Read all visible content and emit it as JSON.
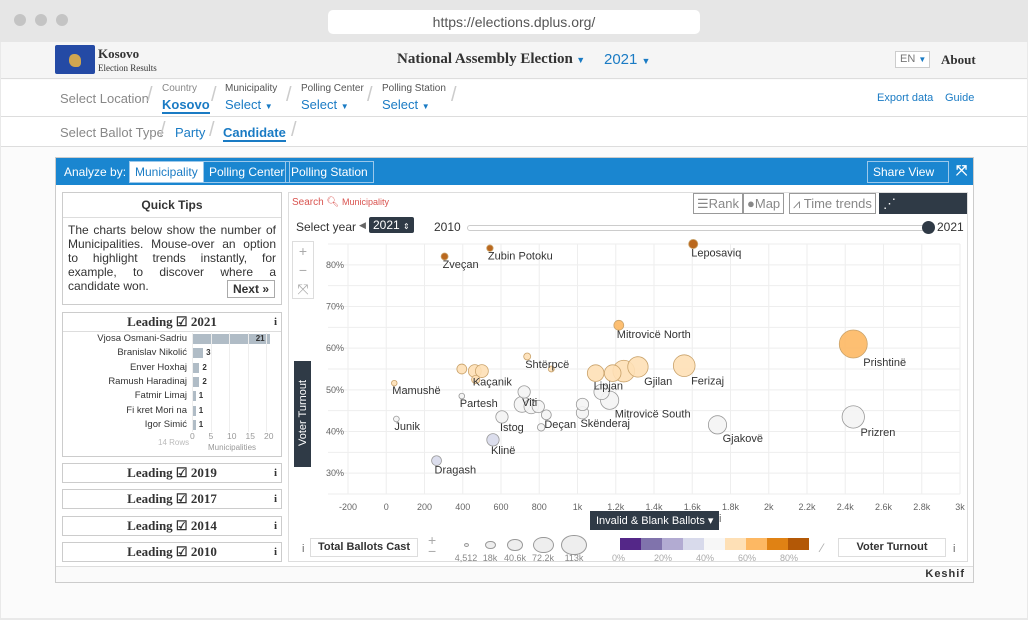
{
  "browser": {
    "url": "https://elections.dplus.org/"
  },
  "header": {
    "brand": "Kosovo",
    "brand_sub": "Election Results",
    "election": "National Assembly Election",
    "year": "2021",
    "lang": "EN",
    "about": "About"
  },
  "location": {
    "label": "Select Location",
    "country_label": "Country",
    "country": "Kosovo",
    "municipality_label": "Municipality",
    "municipality": "Select",
    "center_label": "Polling Center",
    "center": "Select",
    "station_label": "Polling Station",
    "station": "Select",
    "export": "Export data",
    "guide": "Guide"
  },
  "ballot": {
    "label": "Select Ballot Type",
    "party": "Party",
    "candidate": "Candidate"
  },
  "analyze": {
    "label": "Analyze by:",
    "tabs": [
      "Municipality",
      "Polling Center",
      "Polling Station"
    ],
    "active": "Municipality",
    "share": "Share View"
  },
  "tips": {
    "title": "Quick Tips",
    "text": "The charts below show the number of Municipalities. Mouse-over an option to highlight trends instantly, for example, to discover where a candidate won.",
    "next": "Next »"
  },
  "leading": {
    "title": "Leading",
    "year": "2021",
    "rows_label": "14 Rows",
    "axis_label": "Municipalities",
    "ticks": [
      "0",
      "5",
      "10",
      "15",
      "20"
    ],
    "items": [
      {
        "name": "Vjosa Osmani-Sadriu",
        "value": 21
      },
      {
        "name": "Branislav Nikolić",
        "value": 3
      },
      {
        "name": "Enver Hoxhaj",
        "value": 2
      },
      {
        "name": "Ramush Haradinaj",
        "value": 2
      },
      {
        "name": "Fatmir Limaj",
        "value": 1
      },
      {
        "name": "Fi kret Mori na",
        "value": 1
      },
      {
        "name": "Igor Simić",
        "value": 1
      }
    ]
  },
  "other_years": [
    "2019",
    "2017",
    "2014",
    "2010"
  ],
  "views": {
    "search": "Search",
    "search_placeholder": "Municipality",
    "rank": "Rank",
    "map": "Map",
    "trends": "Time trends",
    "correlations": "Correlations",
    "active": "Correlations"
  },
  "year_select": {
    "label": "Select year",
    "value": "2021",
    "min": "2010",
    "max": "2021",
    "position": 1.0
  },
  "chart_data": {
    "type": "scatter",
    "xlabel": "Invalid & Blank Ballots",
    "ylabel": "Voter Turnout",
    "xlim": [
      -200,
      3000
    ],
    "ylim": [
      25,
      85
    ],
    "xticks": [
      "-200",
      "0",
      "200",
      "400",
      "600",
      "800",
      "1k",
      "1.2k",
      "1.4k",
      "1.6k",
      "1.8k",
      "2k",
      "2.2k",
      "2.4k",
      "2.6k",
      "2.8k",
      "3k"
    ],
    "yticks": [
      "30%",
      "40%",
      "50%",
      "60%",
      "70%",
      "80%"
    ],
    "grid": true,
    "size_label": "Total Ballots Cast",
    "color_label": "Voter Turnout",
    "size_legend": [
      "4,512",
      "18k",
      "40.6k",
      "72.2k",
      "113k"
    ],
    "color_legend": [
      "0%",
      "20%",
      "40%",
      "60%",
      "80%"
    ],
    "color_scale": [
      "#542788",
      "#8073ac",
      "#b2abd2",
      "#d8daeb",
      "#f7f7f7",
      "#fee0b6",
      "#fdb863",
      "#e08214",
      "#b35806"
    ],
    "points": [
      {
        "name": "Zveçan",
        "x": 305,
        "y": 82,
        "size": 7000
      },
      {
        "name": "Zubin Potoku",
        "x": 542,
        "y": 84,
        "size": 6000
      },
      {
        "name": "Leposaviq",
        "x": 1605,
        "y": 85,
        "size": 12000
      },
      {
        "name": "Mitrovicë North",
        "x": 1216,
        "y": 65.5,
        "size": 14000
      },
      {
        "name": "Prishtinë",
        "x": 2442,
        "y": 61,
        "size": 113000
      },
      {
        "name": "Ferizaj",
        "x": 1558,
        "y": 55.8,
        "size": 68000
      },
      {
        "name": "Gjilan",
        "x": 1316,
        "y": 55.5,
        "size": 60000
      },
      {
        "name": "",
        "x": 1242,
        "y": 54.5,
        "size": 68000
      },
      {
        "name": "Lipjan",
        "x": 1095,
        "y": 54,
        "size": 40000
      },
      {
        "name": "",
        "x": 1184,
        "y": 54,
        "size": 40000
      },
      {
        "name": "Shtërpcë",
        "x": 737,
        "y": 58,
        "size": 7000
      },
      {
        "name": "",
        "x": 863,
        "y": 55,
        "size": 5000
      },
      {
        "name": "Kaçanik",
        "x": 463,
        "y": 54.5,
        "size": 24000
      },
      {
        "name": "",
        "x": 395,
        "y": 55,
        "size": 14000
      },
      {
        "name": "",
        "x": 500,
        "y": 54.5,
        "size": 24000
      },
      {
        "name": "",
        "x": 468,
        "y": 52.5,
        "size": 10000
      },
      {
        "name": "Mamushë",
        "x": 42,
        "y": 51.6,
        "size": 4512
      },
      {
        "name": "Partesh",
        "x": 395,
        "y": 48.5,
        "size": 4600
      },
      {
        "name": "Junik",
        "x": 53,
        "y": 43,
        "size": 4700
      },
      {
        "name": "Viti",
        "x": 721,
        "y": 49.5,
        "size": 22000
      },
      {
        "name": "",
        "x": 710,
        "y": 46.5,
        "size": 36000
      },
      {
        "name": "",
        "x": 758,
        "y": 46,
        "size": 30000
      },
      {
        "name": "",
        "x": 795,
        "y": 46,
        "size": 22000
      },
      {
        "name": "Istog",
        "x": 605,
        "y": 43.5,
        "size": 22000
      },
      {
        "name": "Deçan",
        "x": 837,
        "y": 44,
        "size": 14000
      },
      {
        "name": "",
        "x": 810,
        "y": 41,
        "size": 8000
      },
      {
        "name": "Skënderaj",
        "x": 1026,
        "y": 44.5,
        "size": 22000
      },
      {
        "name": "",
        "x": 1026,
        "y": 46.5,
        "size": 22000
      },
      {
        "name": "Mitrovicë South",
        "x": 1168,
        "y": 47.5,
        "size": 48000
      },
      {
        "name": "",
        "x": 1126,
        "y": 49.5,
        "size": 34000
      },
      {
        "name": "Gjakovë",
        "x": 1732,
        "y": 41.6,
        "size": 48000
      },
      {
        "name": "Prizren",
        "x": 2442,
        "y": 43.5,
        "size": 72200
      },
      {
        "name": "Klinë",
        "x": 558,
        "y": 38,
        "size": 22000
      },
      {
        "name": "Dragash",
        "x": 263,
        "y": 33,
        "size": 14000
      }
    ]
  },
  "footer": {
    "brand": "Keshif"
  }
}
